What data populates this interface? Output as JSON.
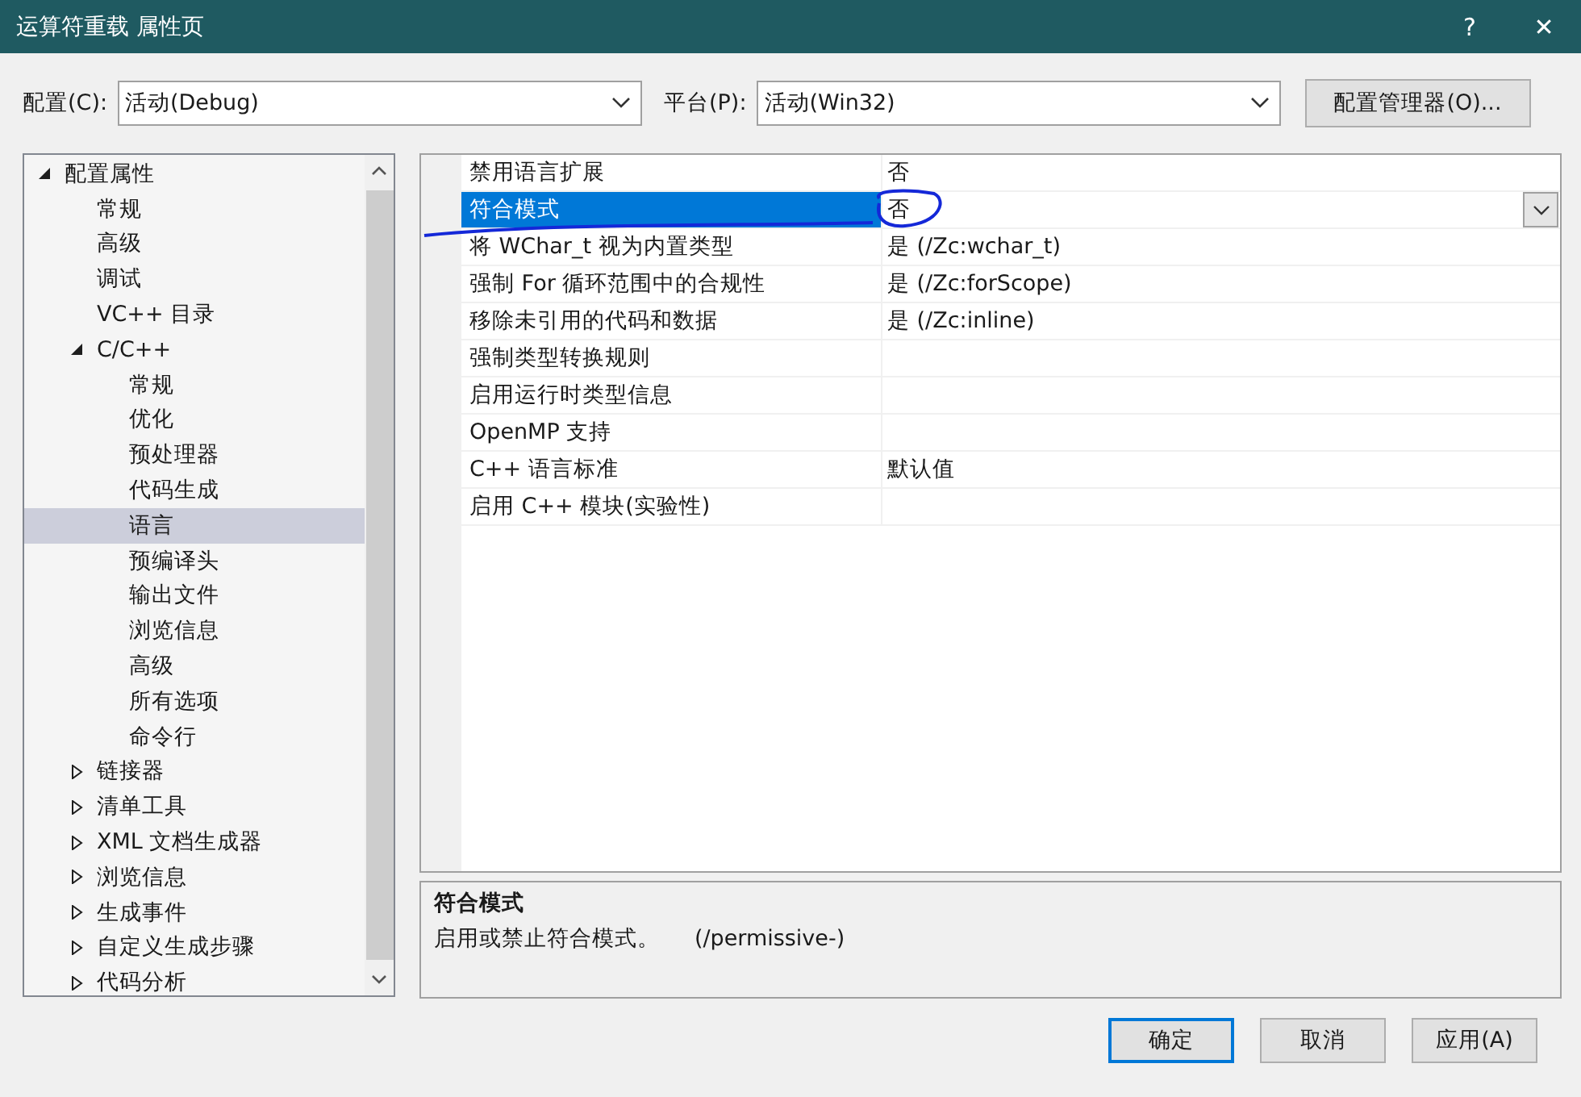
{
  "window": {
    "title": "运算符重载 属性页",
    "help": "?",
    "close": "✕"
  },
  "config": {
    "label": "配置(C):",
    "value": "活动(Debug)"
  },
  "platform": {
    "label": "平台(P):",
    "value": "活动(Win32)"
  },
  "config_manager": "配置管理器(O)...",
  "tree": [
    {
      "label": "配置属性",
      "expanded": true,
      "selected": false,
      "children": [
        {
          "label": "常规",
          "selected": false
        },
        {
          "label": "高级",
          "selected": false
        },
        {
          "label": "调试",
          "selected": false
        },
        {
          "label": "VC++ 目录",
          "selected": false
        },
        {
          "label": "C/C++",
          "expanded": true,
          "selected": false,
          "children": [
            {
              "label": "常规",
              "selected": false
            },
            {
              "label": "优化",
              "selected": false
            },
            {
              "label": "预处理器",
              "selected": false
            },
            {
              "label": "代码生成",
              "selected": false
            },
            {
              "label": "语言",
              "selected": true
            },
            {
              "label": "预编译头",
              "selected": false
            },
            {
              "label": "输出文件",
              "selected": false
            },
            {
              "label": "浏览信息",
              "selected": false
            },
            {
              "label": "高级",
              "selected": false
            },
            {
              "label": "所有选项",
              "selected": false
            },
            {
              "label": "命令行",
              "selected": false
            }
          ]
        },
        {
          "label": "链接器",
          "expanded": false,
          "selected": false
        },
        {
          "label": "清单工具",
          "expanded": false,
          "selected": false
        },
        {
          "label": "XML 文档生成器",
          "expanded": false,
          "selected": false
        },
        {
          "label": "浏览信息",
          "expanded": false,
          "selected": false
        },
        {
          "label": "生成事件",
          "expanded": false,
          "selected": false
        },
        {
          "label": "自定义生成步骤",
          "expanded": false,
          "selected": false
        },
        {
          "label": "代码分析",
          "expanded": false,
          "selected": false
        }
      ]
    }
  ],
  "properties": [
    {
      "name": "禁用语言扩展",
      "value": "否",
      "selected": false
    },
    {
      "name": "符合模式",
      "value": "否",
      "selected": true
    },
    {
      "name": "将 WChar_t 视为内置类型",
      "value": "是 (/Zc:wchar_t)",
      "selected": false
    },
    {
      "name": "强制 For 循环范围中的合规性",
      "value": "是 (/Zc:forScope)",
      "selected": false
    },
    {
      "name": "移除未引用的代码和数据",
      "value": "是 (/Zc:inline)",
      "selected": false
    },
    {
      "name": "强制类型转换规则",
      "selected": false
    },
    {
      "name": "启用运行时类型信息",
      "selected": false
    },
    {
      "name": "OpenMP 支持",
      "selected": false
    },
    {
      "name": "C++ 语言标准",
      "value": "默认值",
      "selected": false
    },
    {
      "name": "启用 C++ 模块(实验性)",
      "selected": false
    }
  ],
  "description": {
    "title": "符合模式",
    "text": "启用或禁止符合模式。     (/permissive-)"
  },
  "buttons": [
    {
      "label": "确定",
      "default": true
    },
    {
      "label": "取消",
      "default": false
    },
    {
      "label": "应用(A)",
      "default": false
    }
  ]
}
